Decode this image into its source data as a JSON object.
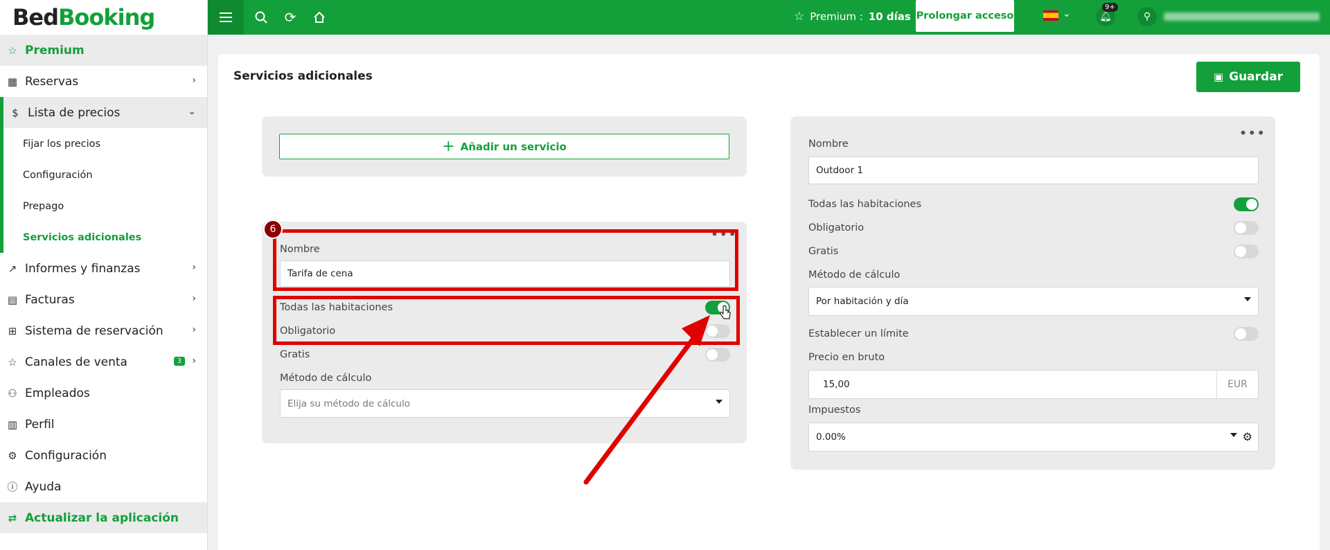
{
  "app": {
    "logo_part1": "Bed",
    "logo_part2": "Booking"
  },
  "topbar": {
    "premium_label": "Premium :",
    "premium_days": "10 días",
    "extend_button": "Prolongar acceso",
    "notifications_badge": "9+",
    "language": "es"
  },
  "sidebar": {
    "premium": "Premium",
    "reservas": "Reservas",
    "lista_precios": "Lista de precios",
    "sub": [
      "Fijar los precios",
      "Configuración",
      "Prepago",
      "Servicios adicionales"
    ],
    "informes": "Informes y finanzas",
    "facturas": "Facturas",
    "sistema": "Sistema de reservación",
    "canales": "Canales de venta",
    "canales_badge": "3",
    "empleados": "Empleados",
    "perfil": "Perfil",
    "configuracion": "Configuración",
    "ayuda": "Ayuda",
    "actualizar": "Actualizar la aplicación"
  },
  "main": {
    "title": "Servicios adicionales",
    "save_button": "Guardar",
    "add_service": "Añadir un servicio",
    "step_number": "6",
    "left_form": {
      "nombre_label": "Nombre",
      "nombre_value": "Tarifa de cena",
      "todas_label": "Todas las habitaciones",
      "todas_on": true,
      "obligatorio_label": "Obligatorio",
      "obligatorio_on": false,
      "gratis_label": "Gratis",
      "gratis_on": false,
      "metodo_label": "Método de cálculo",
      "metodo_placeholder": "Elija su método de cálculo"
    },
    "right_form": {
      "nombre_label": "Nombre",
      "nombre_value": "Outdoor 1",
      "todas_label": "Todas las habitaciones",
      "todas_on": true,
      "obligatorio_label": "Obligatorio",
      "obligatorio_on": false,
      "gratis_label": "Gratis",
      "gratis_on": false,
      "metodo_label": "Método de cálculo",
      "metodo_value": "Por habitación y día",
      "limite_label": "Establecer un límite",
      "limite_on": false,
      "precio_label": "Precio en bruto",
      "precio_value": "15,00",
      "currency": "EUR",
      "impuestos_label": "Impuestos",
      "impuestos_value": "0.00%"
    }
  },
  "colors": {
    "brand": "#13a03a",
    "annotation": "#e00000"
  }
}
